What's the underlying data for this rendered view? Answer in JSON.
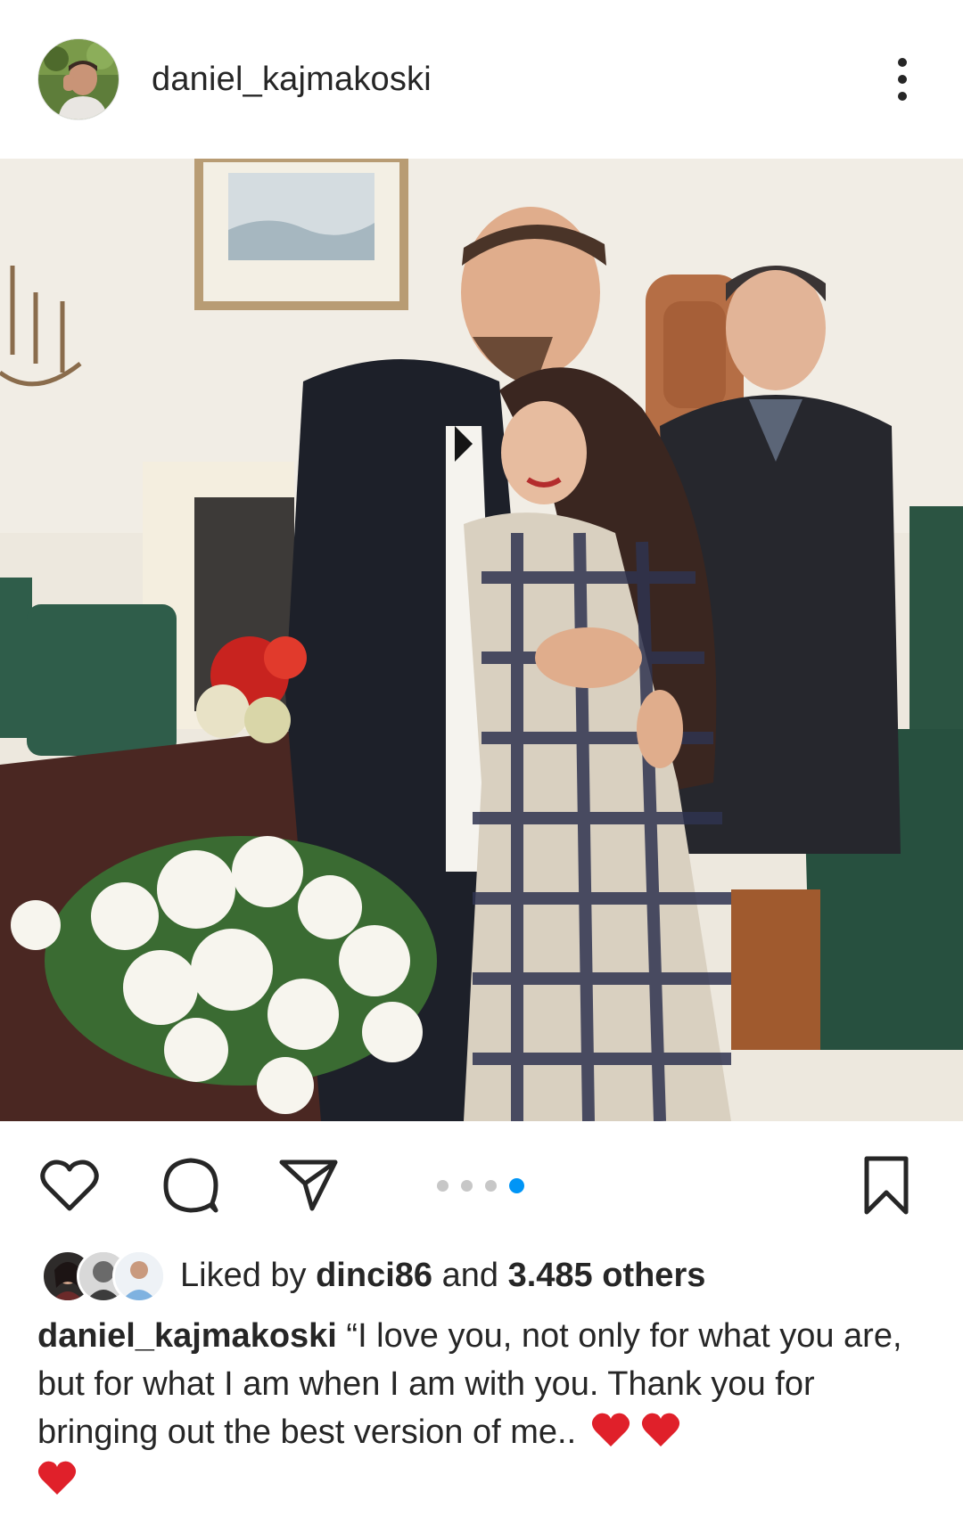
{
  "post": {
    "username": "daniel_kajmakoski",
    "avatar_icon": "profile-photo",
    "more_icon": "more-vertical-icon"
  },
  "photo": {
    "description_icon": "post-photo"
  },
  "actions": {
    "like_icon": "heart-outline-icon",
    "comment_icon": "comment-bubble-icon",
    "share_icon": "paper-plane-icon",
    "save_icon": "bookmark-icon",
    "carousel_total": 4,
    "carousel_active": 4,
    "active_dot_color": "#0095f6",
    "inactive_dot_color": "#c7c7c7"
  },
  "likes": {
    "prefix": "Liked by ",
    "first_liker": "dinci86",
    "middle": " and ",
    "others": "3.485 others"
  },
  "caption": {
    "username": "daniel_kajmakoski",
    "text": " “I love you, not only for what you are, but for what I am when I am with you. Thank you for bringing out the best version of me.. ",
    "emoji_icon": "red-heart-emoji",
    "emoji_color": "#e0202a"
  }
}
